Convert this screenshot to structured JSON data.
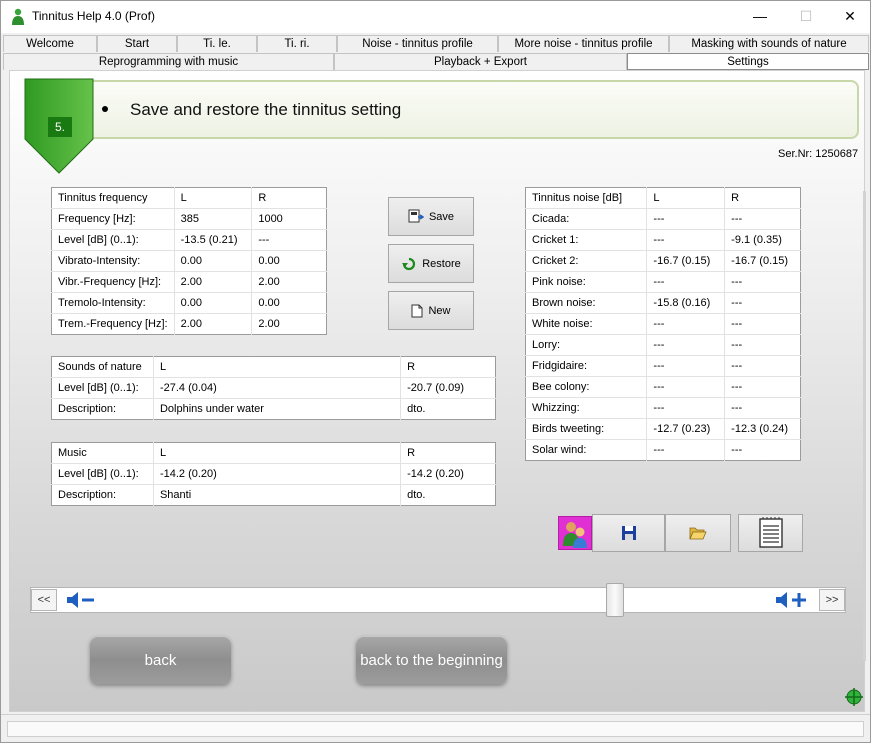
{
  "window": {
    "title": "Tinnitus Help 4.0 (Prof)",
    "controls": {
      "minimize": "—",
      "maximize": "☐",
      "close": "✕"
    }
  },
  "tabs_row1": [
    "Welcome",
    "Start",
    "Ti. le.",
    "Ti. ri.",
    "Noise - tinnitus profile",
    "More noise - tinnitus profile",
    "Masking with sounds of nature"
  ],
  "tabs_row2": [
    "Reprogramming with music",
    "Playback + Export",
    "Settings"
  ],
  "active_tab": "Settings",
  "step": {
    "number": "5.",
    "title": "Save and restore the tinnitus setting"
  },
  "serial": "Ser.Nr: 1250687",
  "tinnitus_frequency_table": {
    "headers": [
      "Tinnitus frequency",
      "L",
      "R"
    ],
    "rows": [
      [
        "Frequency [Hz]:",
        "385",
        "1000"
      ],
      [
        "Level [dB] (0..1):",
        "-13.5 (0.21)",
        "---"
      ],
      [
        "Vibrato-Intensity:",
        "0.00",
        "0.00"
      ],
      [
        "Vibr.-Frequency [Hz]:",
        "2.00",
        "2.00"
      ],
      [
        "Tremolo-Intensity:",
        "0.00",
        "0.00"
      ],
      [
        "Trem.-Frequency [Hz]:",
        "2.00",
        "2.00"
      ]
    ]
  },
  "sounds_of_nature_table": {
    "headers": [
      "Sounds of nature",
      "L",
      "R"
    ],
    "rows": [
      [
        "Level [dB] (0..1):",
        "-27.4 (0.04)",
        "-20.7 (0.09)"
      ],
      [
        "Description:",
        "Dolphins under water",
        "dto."
      ]
    ]
  },
  "music_table": {
    "headers": [
      "Music",
      "L",
      "R"
    ],
    "rows": [
      [
        "Level [dB] (0..1):",
        "-14.2 (0.20)",
        "-14.2 (0.20)"
      ],
      [
        "Description:",
        "Shanti",
        "dto."
      ]
    ]
  },
  "tinnitus_noise_table": {
    "headers": [
      "Tinnitus noise [dB]",
      "L",
      "R"
    ],
    "rows": [
      [
        "Cicada:",
        "---",
        "---"
      ],
      [
        "Cricket 1:",
        "---",
        "-9.1 (0.35)"
      ],
      [
        "Cricket 2:",
        "-16.7 (0.15)",
        "-16.7 (0.15)"
      ],
      [
        "Pink noise:",
        "---",
        "---"
      ],
      [
        "Brown noise:",
        "-15.8 (0.16)",
        "---"
      ],
      [
        "White noise:",
        "---",
        "---"
      ],
      [
        "Lorry:",
        "---",
        "---"
      ],
      [
        "Fridgidaire:",
        "---",
        "---"
      ],
      [
        "Bee colony:",
        "---",
        "---"
      ],
      [
        "Whizzing:",
        "---",
        "---"
      ],
      [
        "Birds tweeting:",
        "-12.7 (0.23)",
        "-12.3 (0.24)"
      ],
      [
        "Solar wind:",
        "---",
        "---"
      ]
    ]
  },
  "actions": {
    "save": "Save",
    "restore": "Restore",
    "new": "New"
  },
  "icon_buttons": [
    "users-icon",
    "floppy-disk-icon",
    "open-folder-icon",
    "notepad-icon"
  ],
  "volume": {
    "prev": "<<",
    "next": ">>",
    "level": 0.7
  },
  "nav": {
    "back": "back",
    "back_to_beginning": "back to the beginning"
  },
  "colors": {
    "step_green": "#187a10",
    "banner_border": "#c8d7a8",
    "speaker_blue": "#1e5fbf"
  }
}
